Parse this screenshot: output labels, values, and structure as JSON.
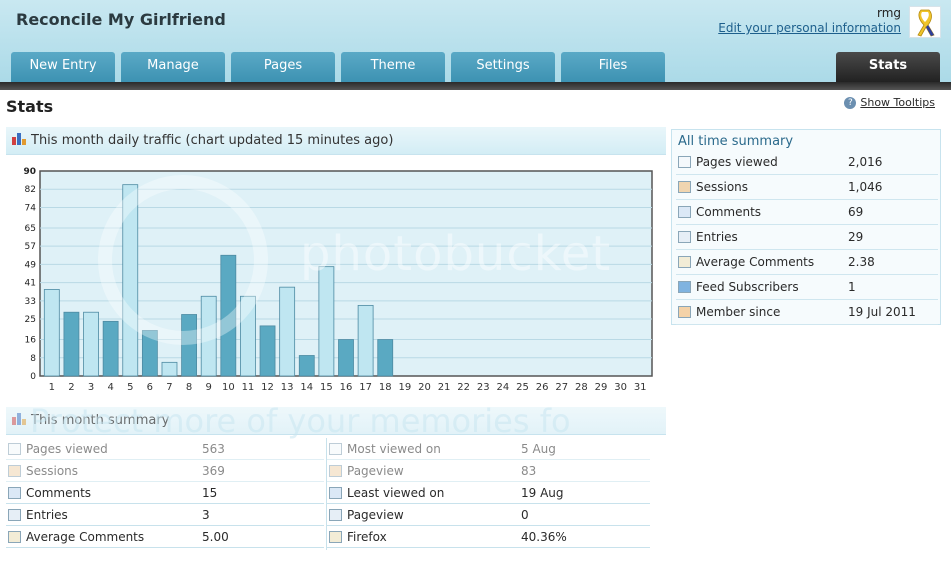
{
  "header": {
    "site_title": "Reconcile My Girlfriend",
    "username": "rmg",
    "edit_info": "Edit your personal information"
  },
  "tabs": [
    {
      "label": "New Entry"
    },
    {
      "label": "Manage"
    },
    {
      "label": "Pages"
    },
    {
      "label": "Theme"
    },
    {
      "label": "Settings"
    },
    {
      "label": "Files"
    },
    {
      "label": "Stats",
      "active": true
    }
  ],
  "page": {
    "title": "Stats",
    "show_tooltips": "Show Tooltips"
  },
  "traffic_panel": {
    "title": "This month daily traffic (chart updated 15 minutes ago)"
  },
  "chart_data": {
    "type": "bar",
    "y_ticks": [
      0,
      8,
      16,
      25,
      33,
      41,
      49,
      57,
      65,
      74,
      82,
      90
    ],
    "ylim": [
      0,
      90
    ],
    "grid": true,
    "categories": [
      "1",
      "2",
      "3",
      "4",
      "5",
      "6",
      "7",
      "8",
      "9",
      "10",
      "11",
      "12",
      "13",
      "14",
      "15",
      "16",
      "17",
      "18",
      "19",
      "20",
      "21",
      "22",
      "23",
      "24",
      "25",
      "26",
      "27",
      "28",
      "29",
      "30",
      "31"
    ],
    "values": [
      38,
      28,
      28,
      24,
      84,
      20,
      6,
      27,
      35,
      53,
      35,
      22,
      39,
      9,
      48,
      16,
      31,
      16,
      0,
      0,
      0,
      0,
      0,
      0,
      0,
      0,
      0,
      0,
      0,
      0,
      0
    ],
    "colors": {
      "light": "#bfe6f1",
      "dark": "#5aa9c2",
      "bg": "#dff1f7",
      "grid": "#b9d9e5"
    }
  },
  "month_summary": {
    "title": "This month summary",
    "left": [
      {
        "label": "Pages viewed",
        "value": "563"
      },
      {
        "label": "Sessions",
        "value": "369"
      },
      {
        "label": "Comments",
        "value": "15"
      },
      {
        "label": "Entries",
        "value": "3"
      },
      {
        "label": "Average Comments",
        "value": "5.00"
      }
    ],
    "right": [
      {
        "label": "Most viewed on",
        "value": "5 Aug"
      },
      {
        "label": "Pageview",
        "value": "83"
      },
      {
        "label": "Least viewed on",
        "value": "19 Aug"
      },
      {
        "label": "Pageview",
        "value": "0"
      },
      {
        "label": "Firefox",
        "value": "40.36%"
      }
    ]
  },
  "all_time": {
    "title": "All time summary",
    "rows": [
      {
        "label": "Pages viewed",
        "value": "2,016"
      },
      {
        "label": "Sessions",
        "value": "1,046"
      },
      {
        "label": "Comments",
        "value": "69"
      },
      {
        "label": "Entries",
        "value": "29"
      },
      {
        "label": "Average Comments",
        "value": "2.38"
      },
      {
        "label": "Feed Subscribers",
        "value": "1"
      },
      {
        "label": "Member since",
        "value": "19 Jul 2011"
      }
    ]
  },
  "watermark": {
    "line1": "photobucket",
    "line2": "Protect more of your memories fo"
  }
}
